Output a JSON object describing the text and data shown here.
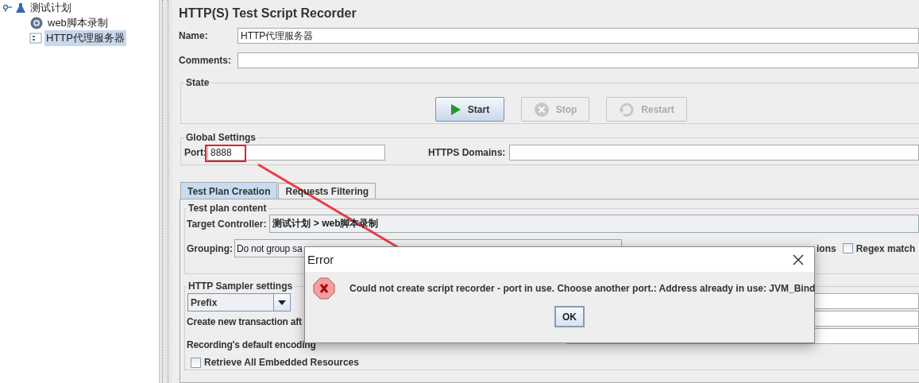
{
  "tree": {
    "root": {
      "label": "测试计划",
      "expanded": true,
      "children": [
        {
          "label": "web脚本录制",
          "kind": "controller",
          "selected": false
        },
        {
          "label": "HTTP代理服务器",
          "kind": "proxy",
          "selected": true
        }
      ]
    }
  },
  "panel": {
    "title": "HTTP(S) Test Script Recorder",
    "name": {
      "label": "Name:",
      "value": "HTTP代理服务器"
    },
    "comments": {
      "label": "Comments:"
    }
  },
  "state": {
    "title": "State",
    "buttons": [
      {
        "label": "Start",
        "kind": "start",
        "disabled": false
      },
      {
        "label": "Stop",
        "kind": "stop",
        "disabled": true
      },
      {
        "label": "Restart",
        "kind": "restart",
        "disabled": true
      }
    ]
  },
  "global_settings": {
    "title": "Global Settings",
    "port": {
      "label": "Port:",
      "value": "8888"
    },
    "https_domains": {
      "label": "HTTPS Domains:"
    }
  },
  "tabs": [
    {
      "label": "Test Plan Creation",
      "selected": true
    },
    {
      "label": "Requests Filtering",
      "selected": false
    }
  ],
  "test_plan_content": {
    "title": "Test plan content",
    "target_controller": {
      "label": "Target Controller:",
      "value": "测试计划 > web脚本录制"
    },
    "grouping": {
      "label": "Grouping:",
      "value": "Do not group sa"
    },
    "option_fragment": "ions",
    "regex_matching": {
      "label": "Regex match",
      "checked": false
    }
  },
  "http_sampler_settings": {
    "title": "HTTP Sampler settings",
    "prefix_select": {
      "value": "Prefix"
    },
    "create_transaction_label": "Create new transaction aft",
    "encoding_label": "Recording's default encoding",
    "retrieve_resources": {
      "label": "Retrieve All Embedded Resources",
      "checked": false
    }
  },
  "dialog": {
    "title": "Error",
    "message": "Could not create script recorder - port in use. Choose another port.: Address already in use: JVM_Bind",
    "button": "OK"
  }
}
